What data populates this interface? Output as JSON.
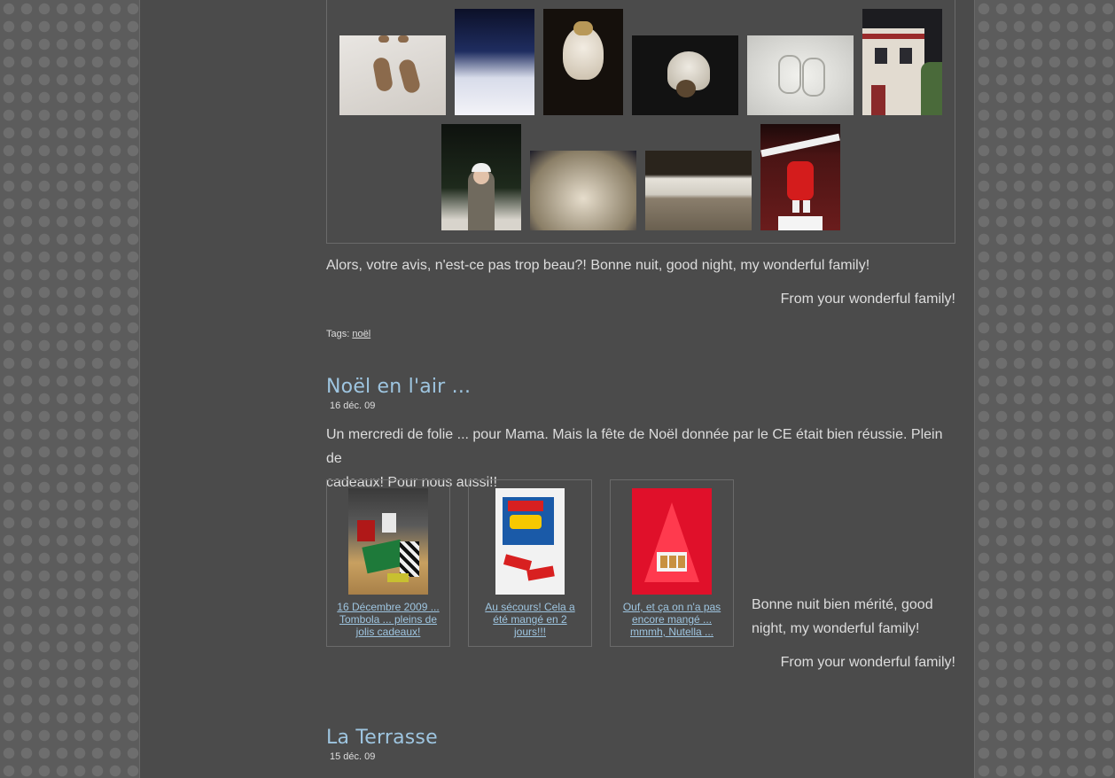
{
  "gallery": {
    "photos": [
      {
        "name": "footprints-in-snow",
        "colors": [
          "#d8d4ce",
          "#efece8",
          "#8b6a4c"
        ]
      },
      {
        "name": "snow-bank-night",
        "colors": [
          "#0f1530",
          "#f3f3f8",
          "#3a4a80"
        ]
      },
      {
        "name": "snow-on-lamp",
        "colors": [
          "#1a1410",
          "#e8e0d4",
          "#3a2a18"
        ]
      },
      {
        "name": "snow-on-garden-figure",
        "colors": [
          "#141414",
          "#e8e4dc",
          "#4a3a2a"
        ]
      },
      {
        "name": "snow-drawing",
        "colors": [
          "#cfcfcc",
          "#eeeeea",
          "#9a9a98"
        ]
      },
      {
        "name": "house-in-snow",
        "colors": [
          "#1e1e22",
          "#e4ddd2",
          "#8a2a2a"
        ]
      },
      {
        "name": "child-in-snow",
        "colors": [
          "#101410",
          "#cfc8bc",
          "#6a6458"
        ]
      },
      {
        "name": "snow-mound-night",
        "colors": [
          "#1a1a28",
          "#cfc8bc",
          "#7a7060"
        ]
      },
      {
        "name": "snow-on-wall",
        "colors": [
          "#2a241c",
          "#e0ddd6",
          "#8a7e6c"
        ]
      },
      {
        "name": "santa-climbing-house",
        "colors": [
          "#3a0e0e",
          "#ffffff",
          "#cc1a1a"
        ]
      }
    ]
  },
  "post1": {
    "text": "Alors, votre avis, n'est-ce pas trop beau?! Bonne nuit, good night, my wonderful family!",
    "signature": "From your wonderful family!",
    "tags_label": "Tags:",
    "tag": "noël"
  },
  "post2": {
    "title": "Noël en l'air ...",
    "date": "16 déc. 09",
    "text_line1": "Un mercredi de folie ... pour Mama. Mais la fête de Noël donnée par le CE était bien réussie. Plein de",
    "text_line2": "cadeaux! Pour nous aussi!!",
    "cards": [
      {
        "caption": [
          "16 Décembre 2009 ...",
          "Tombola ... pleins de",
          "jolis cadeaux!"
        ],
        "colors": [
          "#c8a060",
          "#1e7a3a",
          "#b01818",
          "#e8e8e8"
        ]
      },
      {
        "caption": [
          "Au sécours! Cela a",
          "été mangé en 2",
          "jours!!!"
        ],
        "colors": [
          "#f2f2f2",
          "#1a5aa8",
          "#d82020",
          "#f6c800"
        ]
      },
      {
        "caption": [
          "Ouf, et ça on n'a pas",
          "encore mangé ...",
          "mmmh, Nutella ..."
        ],
        "colors": [
          "#e0102a",
          "#ff3048",
          "#ffffff",
          "#c89040"
        ]
      }
    ],
    "closing_line1": "Bonne nuit bien mérité, good",
    "closing_line2": "night, my wonderful family!",
    "signature": "From your wonderful family!"
  },
  "post3": {
    "title": "La Terrasse",
    "date": "15 déc. 09"
  },
  "colors": {
    "page_bg": "#4b4b4b",
    "title": "#9ec5e0",
    "text": "#dddddd"
  }
}
